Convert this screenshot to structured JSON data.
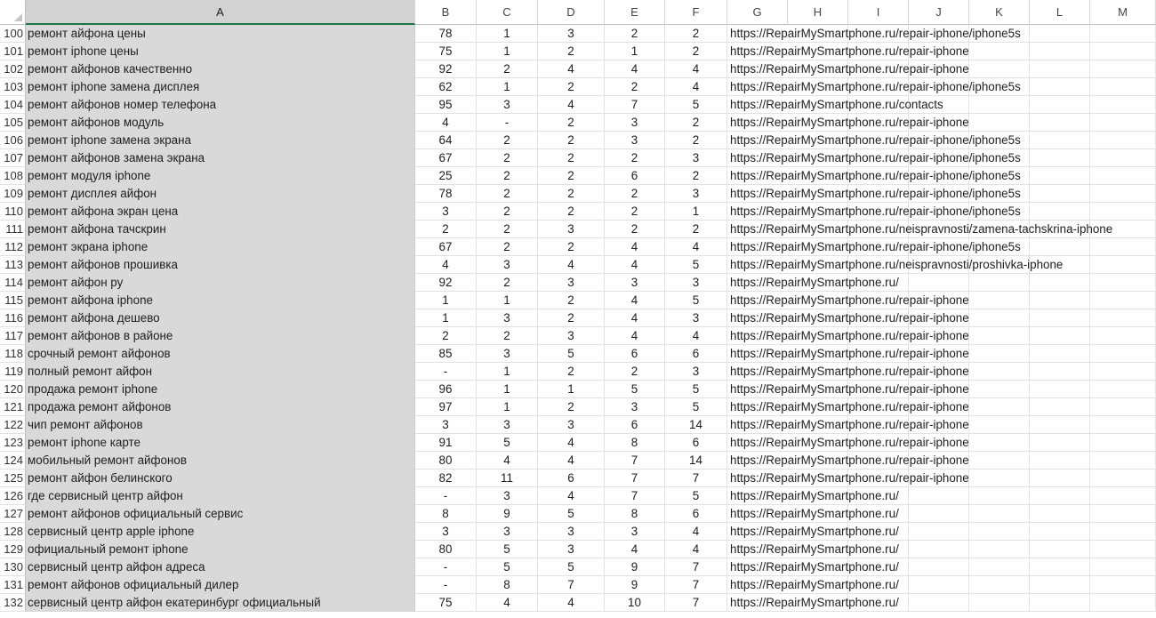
{
  "columns": [
    "A",
    "B",
    "C",
    "D",
    "E",
    "F",
    "G",
    "H",
    "I",
    "J",
    "K",
    "L",
    "M"
  ],
  "selected_column": "A",
  "rows": [
    {
      "n": "100",
      "a": "ремонт айфона цены",
      "b": "78",
      "c": "1",
      "d": "3",
      "e": "2",
      "f": "2",
      "g": "https://RepairMySmartphone.ru/repair-iphone/iphone5s"
    },
    {
      "n": "101",
      "a": "ремонт iphone цены",
      "b": "75",
      "c": "1",
      "d": "2",
      "e": "1",
      "f": "2",
      "g": "https://RepairMySmartphone.ru/repair-iphone"
    },
    {
      "n": "102",
      "a": "ремонт айфонов качественно",
      "b": "92",
      "c": "2",
      "d": "4",
      "e": "4",
      "f": "4",
      "g": "https://RepairMySmartphone.ru/repair-iphone"
    },
    {
      "n": "103",
      "a": "ремонт iphone замена дисплея",
      "b": "62",
      "c": "1",
      "d": "2",
      "e": "2",
      "f": "4",
      "g": "https://RepairMySmartphone.ru/repair-iphone/iphone5s"
    },
    {
      "n": "104",
      "a": "ремонт айфонов номер телефона",
      "b": "95",
      "c": "3",
      "d": "4",
      "e": "7",
      "f": "5",
      "g": "https://RepairMySmartphone.ru/contacts"
    },
    {
      "n": "105",
      "a": "ремонт айфонов модуль",
      "b": "4",
      "c": "-",
      "d": "2",
      "e": "3",
      "f": "2",
      "g": "https://RepairMySmartphone.ru/repair-iphone"
    },
    {
      "n": "106",
      "a": "ремонт iphone замена экрана",
      "b": "64",
      "c": "2",
      "d": "2",
      "e": "3",
      "f": "2",
      "g": "https://RepairMySmartphone.ru/repair-iphone/iphone5s"
    },
    {
      "n": "107",
      "a": "ремонт айфонов замена экрана",
      "b": "67",
      "c": "2",
      "d": "2",
      "e": "2",
      "f": "3",
      "g": "https://RepairMySmartphone.ru/repair-iphone/iphone5s"
    },
    {
      "n": "108",
      "a": "ремонт модуля iphone",
      "b": "25",
      "c": "2",
      "d": "2",
      "e": "6",
      "f": "2",
      "g": "https://RepairMySmartphone.ru/repair-iphone/iphone5s"
    },
    {
      "n": "109",
      "a": "ремонт дисплея айфон",
      "b": "78",
      "c": "2",
      "d": "2",
      "e": "2",
      "f": "3",
      "g": "https://RepairMySmartphone.ru/repair-iphone/iphone5s"
    },
    {
      "n": "110",
      "a": "ремонт айфона экран цена",
      "b": "3",
      "c": "2",
      "d": "2",
      "e": "2",
      "f": "1",
      "g": "https://RepairMySmartphone.ru/repair-iphone/iphone5s"
    },
    {
      "n": "111",
      "a": "ремонт айфона тачскрин",
      "b": "2",
      "c": "2",
      "d": "3",
      "e": "2",
      "f": "2",
      "g": "https://RepairMySmartphone.ru/neispravnosti/zamena-tachskrina-iphone"
    },
    {
      "n": "112",
      "a": "ремонт экрана iphone",
      "b": "67",
      "c": "2",
      "d": "2",
      "e": "4",
      "f": "4",
      "g": "https://RepairMySmartphone.ru/repair-iphone/iphone5s"
    },
    {
      "n": "113",
      "a": "ремонт айфонов прошивка",
      "b": "4",
      "c": "3",
      "d": "4",
      "e": "4",
      "f": "5",
      "g": "https://RepairMySmartphone.ru/neispravnosti/proshivka-iphone"
    },
    {
      "n": "114",
      "a": "ремонт айфон ру",
      "b": "92",
      "c": "2",
      "d": "3",
      "e": "3",
      "f": "3",
      "g": "https://RepairMySmartphone.ru/"
    },
    {
      "n": "115",
      "a": "ремонт айфона iphone",
      "b": "1",
      "c": "1",
      "d": "2",
      "e": "4",
      "f": "5",
      "g": "https://RepairMySmartphone.ru/repair-iphone"
    },
    {
      "n": "116",
      "a": "ремонт айфона дешево",
      "b": "1",
      "c": "3",
      "d": "2",
      "e": "4",
      "f": "3",
      "g": "https://RepairMySmartphone.ru/repair-iphone"
    },
    {
      "n": "117",
      "a": "ремонт айфонов в районе",
      "b": "2",
      "c": "2",
      "d": "3",
      "e": "4",
      "f": "4",
      "g": "https://RepairMySmartphone.ru/repair-iphone"
    },
    {
      "n": "118",
      "a": "срочный ремонт айфонов",
      "b": "85",
      "c": "3",
      "d": "5",
      "e": "6",
      "f": "6",
      "g": "https://RepairMySmartphone.ru/repair-iphone"
    },
    {
      "n": "119",
      "a": "полный ремонт айфон",
      "b": "-",
      "c": "1",
      "d": "2",
      "e": "2",
      "f": "3",
      "g": "https://RepairMySmartphone.ru/repair-iphone"
    },
    {
      "n": "120",
      "a": "продажа ремонт iphone",
      "b": "96",
      "c": "1",
      "d": "1",
      "e": "5",
      "f": "5",
      "g": "https://RepairMySmartphone.ru/repair-iphone"
    },
    {
      "n": "121",
      "a": "продажа ремонт айфонов",
      "b": "97",
      "c": "1",
      "d": "2",
      "e": "3",
      "f": "5",
      "g": "https://RepairMySmartphone.ru/repair-iphone"
    },
    {
      "n": "122",
      "a": "чип ремонт айфонов",
      "b": "3",
      "c": "3",
      "d": "3",
      "e": "6",
      "f": "14",
      "g": "https://RepairMySmartphone.ru/repair-iphone"
    },
    {
      "n": "123",
      "a": "ремонт iphone карте",
      "b": "91",
      "c": "5",
      "d": "4",
      "e": "8",
      "f": "6",
      "g": "https://RepairMySmartphone.ru/repair-iphone"
    },
    {
      "n": "124",
      "a": "мобильный ремонт айфонов",
      "b": "80",
      "c": "4",
      "d": "4",
      "e": "7",
      "f": "14",
      "g": "https://RepairMySmartphone.ru/repair-iphone"
    },
    {
      "n": "125",
      "a": "ремонт айфон белинского",
      "b": "82",
      "c": "11",
      "d": "6",
      "e": "7",
      "f": "7",
      "g": "https://RepairMySmartphone.ru/repair-iphone"
    },
    {
      "n": "126",
      "a": "где сервисный центр айфон",
      "b": "-",
      "c": "3",
      "d": "4",
      "e": "7",
      "f": "5",
      "g": "https://RepairMySmartphone.ru/"
    },
    {
      "n": "127",
      "a": "ремонт айфонов официальный сервис",
      "b": "8",
      "c": "9",
      "d": "5",
      "e": "8",
      "f": "6",
      "g": "https://RepairMySmartphone.ru/"
    },
    {
      "n": "128",
      "a": "сервисный центр apple iphone",
      "b": "3",
      "c": "3",
      "d": "3",
      "e": "3",
      "f": "4",
      "g": "https://RepairMySmartphone.ru/"
    },
    {
      "n": "129",
      "a": "официальный ремонт iphone",
      "b": "80",
      "c": "5",
      "d": "3",
      "e": "4",
      "f": "4",
      "g": "https://RepairMySmartphone.ru/"
    },
    {
      "n": "130",
      "a": "сервисный центр айфон адреса",
      "b": "-",
      "c": "5",
      "d": "5",
      "e": "9",
      "f": "7",
      "g": "https://RepairMySmartphone.ru/"
    },
    {
      "n": "131",
      "a": "ремонт айфонов официальный дилер",
      "b": "-",
      "c": "8",
      "d": "7",
      "e": "9",
      "f": "7",
      "g": "https://RepairMySmartphone.ru/"
    },
    {
      "n": "132",
      "a": "сервисный центр айфон екатеринбург официальный",
      "b": "75",
      "c": "4",
      "d": "4",
      "e": "10",
      "f": "7",
      "g": "https://RepairMySmartphone.ru/"
    }
  ]
}
